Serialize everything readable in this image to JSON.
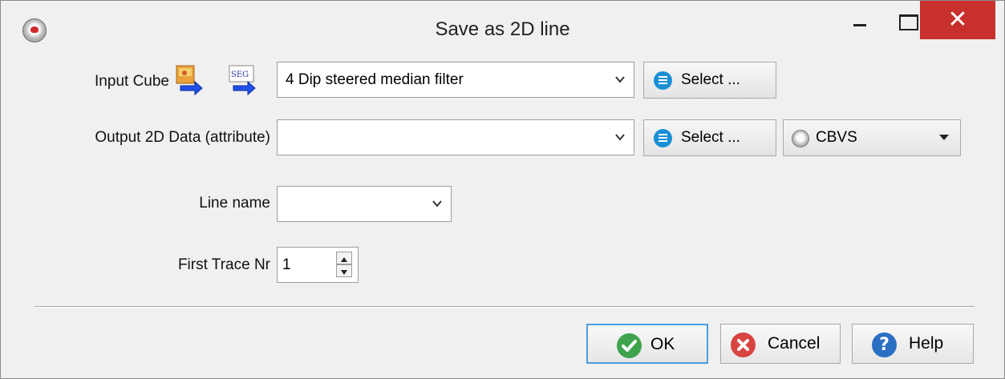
{
  "window": {
    "title": "Save as 2D line",
    "close_glyph": "✕"
  },
  "input_cube": {
    "label": "Input Cube",
    "icons": [
      "import-cube-icon",
      "segy-import-icon"
    ],
    "segy_icon_text": "SEG",
    "value": "4 Dip steered median filter",
    "select_label": "Select ..."
  },
  "output_data": {
    "label": "Output 2D Data (attribute)",
    "value": "",
    "select_label": "Select ...",
    "format_value": "CBVS"
  },
  "line_name": {
    "label": "Line name",
    "value": ""
  },
  "first_trace": {
    "label": "First Trace Nr",
    "value": "1"
  },
  "buttons": {
    "ok": "OK",
    "cancel": "Cancel",
    "help": "Help"
  },
  "colors": {
    "close_red": "#c7302c",
    "ok_green": "#3fa34d",
    "cancel_red": "#d64541",
    "help_blue": "#2a6fc4",
    "list_icon_blue": "#1a8fd6"
  }
}
